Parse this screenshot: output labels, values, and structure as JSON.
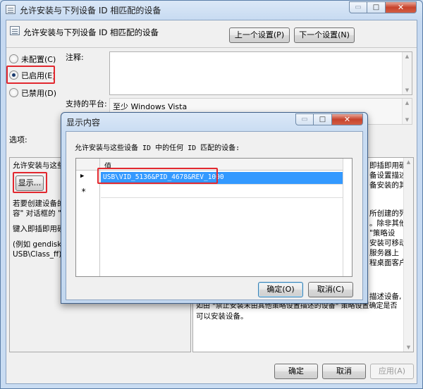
{
  "main": {
    "title": "允许安装与下列设备 ID 相匹配的设备",
    "setting_name": "允许安装与下列设备 ID 相匹配的设备",
    "prev_label": "上一个设置(P)",
    "next_label": "下一个设置(N)",
    "radios": [
      {
        "label": "未配置(C)",
        "checked": false
      },
      {
        "label": "已启用(E)",
        "checked": true
      },
      {
        "label": "已禁用(D)",
        "checked": false
      }
    ],
    "comment_label": "注释:",
    "platform_label": "支持的平台:",
    "platform_value": "至少 Windows Vista",
    "options_label": "选项:",
    "left_panel": {
      "line1": "允许安装与这些",
      "show_button": "显示...",
      "lines": [
        "若要创建设备的",
        "容\" 对话框的 \"",
        "键入即插即用硬",
        "(例如 gendisk、",
        "USB\\Class_ff)。"
      ]
    },
    "right_panel": {
      "lines": [
        "即插即用硬",
        "备设置描述",
        "备安装的其",
        "所创建的列",
        "。除非其他",
        "\"策略设",
        "安装可移动",
        "服务器上",
        "程桌面客户",
        "描述设备,",
        "如由 \"禁止安装未由其他策略设置描述的设备\" 策略设置确定是否",
        "可以安装设备。"
      ]
    },
    "buttons": {
      "ok": "确定",
      "cancel": "取消",
      "apply": "应用(A)"
    }
  },
  "dialog": {
    "title": "显示内容",
    "instruction": "允许安装与这些设备 ID 中的任何 ID 匹配的设备:",
    "column_header": "值",
    "rows": [
      "USB\\VID_5136&PID_4678&REV_1000"
    ],
    "new_row_marker": "*",
    "ok": "确定(O)",
    "cancel": "取消(C)"
  },
  "caption_buttons": {
    "minimize": "▭",
    "maximize": "□",
    "close": "✕"
  }
}
